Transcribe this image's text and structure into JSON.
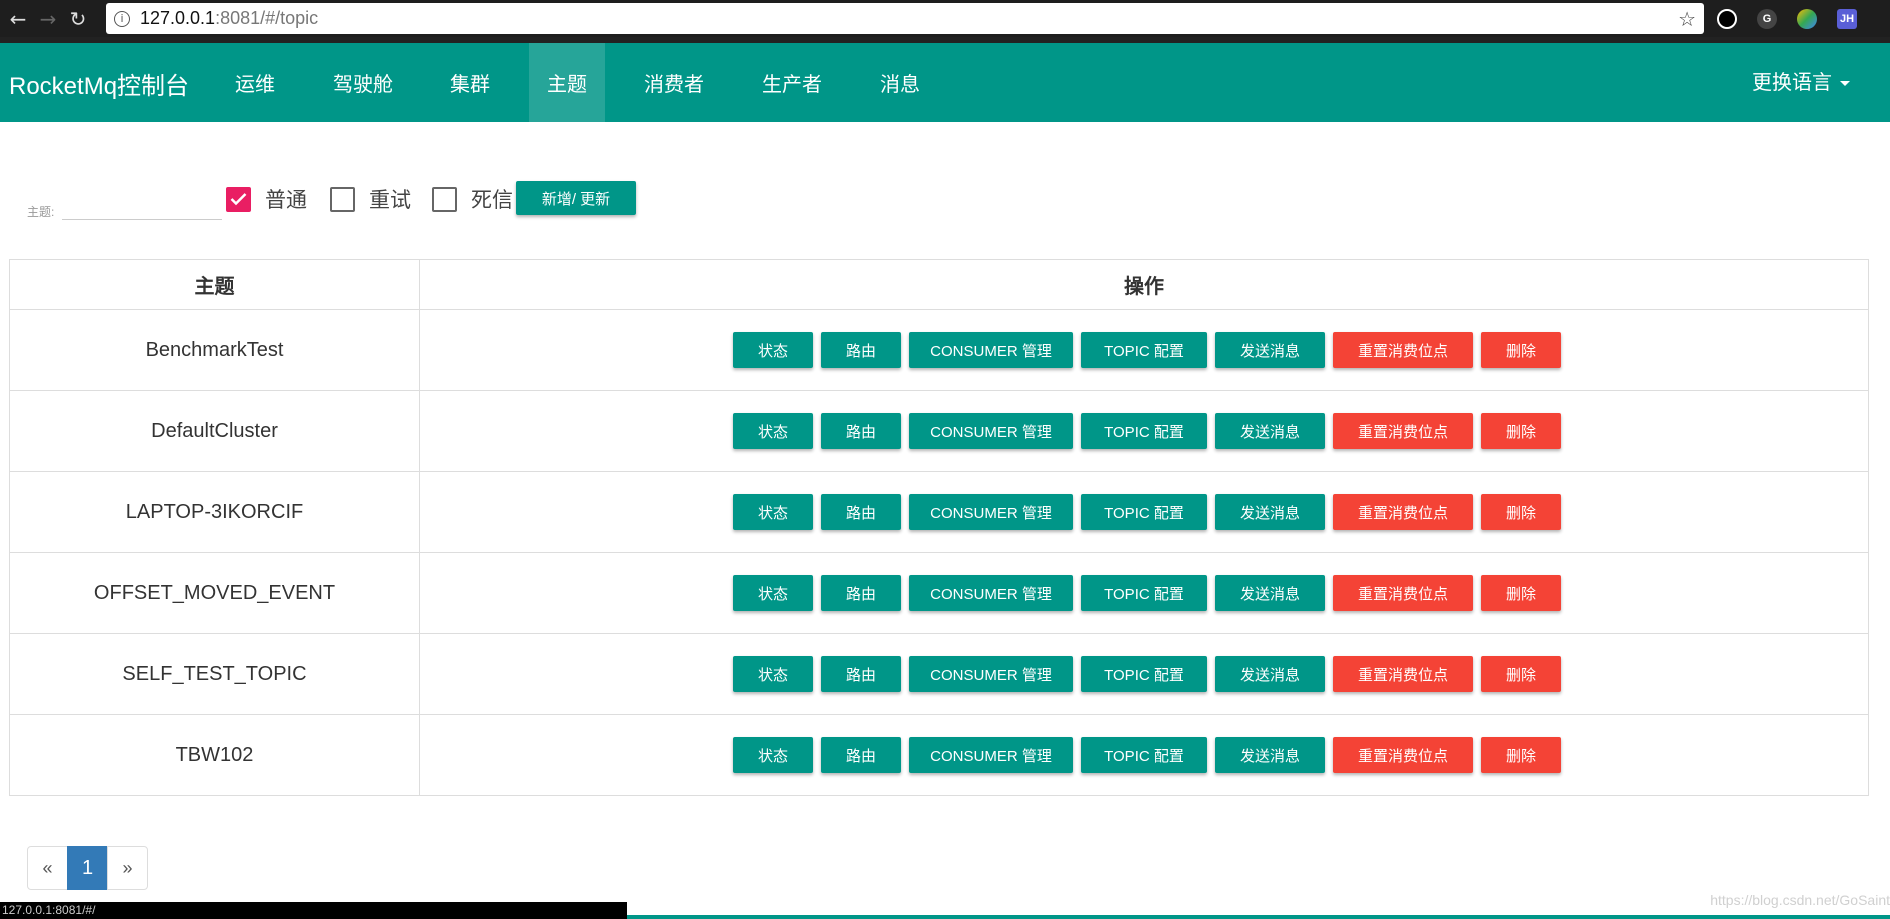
{
  "browser": {
    "url_host": "127.0.0.1",
    "url_path": ":8081/#/topic"
  },
  "navbar": {
    "brand": "RocketMq控制台",
    "items": [
      "运维",
      "驾驶舱",
      "集群",
      "主题",
      "消费者",
      "生产者",
      "消息"
    ],
    "active": "主题",
    "language": "更换语言"
  },
  "filter": {
    "topic_label": "主题:",
    "topic_value": "",
    "checkboxes": [
      {
        "label": "普通",
        "checked": true
      },
      {
        "label": "重试",
        "checked": false
      },
      {
        "label": "死信",
        "checked": false
      }
    ],
    "add_button": "新增/ 更新"
  },
  "table": {
    "headers": [
      "主题",
      "操作"
    ],
    "rows": [
      "BenchmarkTest",
      "DefaultCluster",
      "LAPTOP-3IKORCIF",
      "OFFSET_MOVED_EVENT",
      "SELF_TEST_TOPIC",
      "TBW102"
    ],
    "actions": [
      "状态",
      "路由",
      "CONSUMER 管理",
      "TOPIC 配置",
      "发送消息",
      "重置消费位点",
      "删除"
    ]
  },
  "pagination": {
    "prev": "«",
    "current": "1",
    "next": "»"
  },
  "status_bar": "127.0.0.1:8081/#/",
  "watermark": "https://blog.csdn.net/GoSaint",
  "colors": {
    "primary": "#009688",
    "danger": "#f44336",
    "checkbox": "#e91e63",
    "page_active": "#337ab7"
  }
}
